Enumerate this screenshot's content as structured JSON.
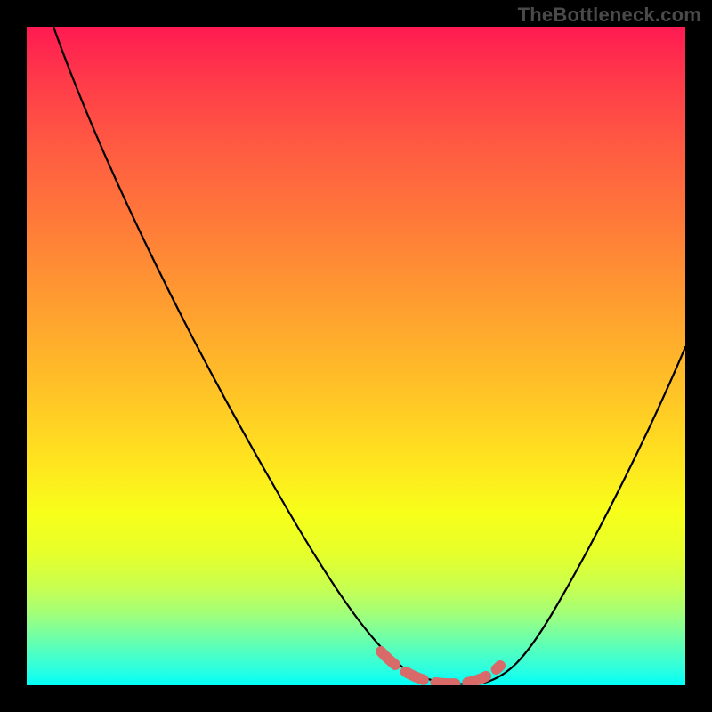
{
  "watermark": "TheBottleneck.com",
  "colors": {
    "background": "#000000",
    "curve": "#000000",
    "marker": "#d86a6a",
    "gradient_top": "#ff1a52",
    "gradient_bottom": "#00fff9"
  },
  "chart_data": {
    "type": "line",
    "title": "",
    "xlabel": "",
    "ylabel": "",
    "xlim": [
      0,
      100
    ],
    "ylim": [
      0,
      100
    ],
    "x": [
      0,
      5,
      10,
      15,
      20,
      25,
      30,
      35,
      40,
      45,
      50,
      55,
      60,
      62,
      65,
      68,
      70,
      75,
      80,
      85,
      90,
      95,
      100
    ],
    "series": [
      {
        "name": "bottleneck-curve",
        "values": [
          100,
          93,
          85,
          77,
          69,
          61,
          52,
          44,
          35,
          26,
          17,
          9,
          3,
          1,
          0,
          0,
          1,
          6,
          14,
          24,
          35,
          46,
          57
        ]
      }
    ],
    "annotations": {
      "optimal_band": {
        "x_start": 55,
        "x_end": 72,
        "note": "dashed marker at curve minimum"
      }
    }
  }
}
